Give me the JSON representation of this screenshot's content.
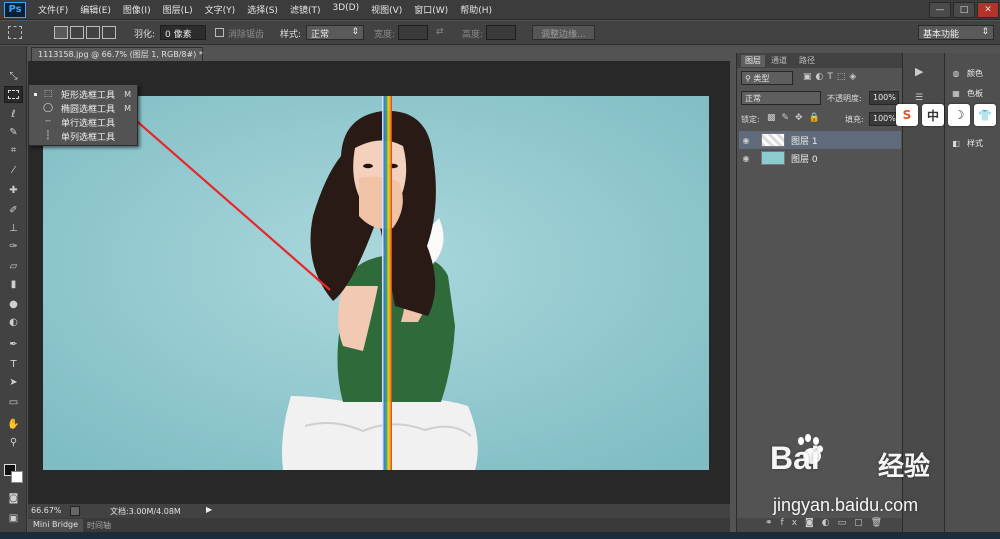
{
  "app": {
    "logo": "Ps"
  },
  "menu": [
    "文件(F)",
    "编辑(E)",
    "图像(I)",
    "图层(L)",
    "文字(Y)",
    "选择(S)",
    "滤镜(T)",
    "3D(D)",
    "视图(V)",
    "窗口(W)",
    "帮助(H)"
  ],
  "window_controls": {
    "minimize": "—",
    "restore": "□",
    "close": "✕"
  },
  "options": {
    "feather_label": "羽化:",
    "feather_value": "0 像素",
    "antialias_label": "消除锯齿",
    "style_label": "样式:",
    "style_value": "正常",
    "width_label": "宽度:",
    "height_label": "高度:",
    "refine_edge": "调整边缘...",
    "workspace": "基本功能"
  },
  "document": {
    "tab_title": "1113158.jpg @ 66.7% (图层 1, RGB/8#) *",
    "zoom": "66.67%",
    "doc_size": "文档:3.00M/4.08M",
    "bottom_tabs": [
      "Mini Bridge",
      "时间轴"
    ]
  },
  "flyout": {
    "items": [
      {
        "label": "矩形选框工具",
        "key": "M",
        "icon": "rect-marquee-icon"
      },
      {
        "label": "椭圆选框工具",
        "key": "M",
        "icon": "ellipse-marquee-icon"
      },
      {
        "label": "单行选框工具",
        "key": "",
        "icon": "single-row-marquee-icon"
      },
      {
        "label": "单列选框工具",
        "key": "",
        "icon": "single-column-marquee-icon"
      }
    ]
  },
  "layers_panel": {
    "tabs": [
      "图层",
      "通道",
      "路径"
    ],
    "kind_filter": "类型",
    "blend_mode": "正常",
    "opacity_label": "不透明度:",
    "opacity_value": "100%",
    "lock_label": "锁定:",
    "fill_label": "填充:",
    "fill_value": "100%",
    "layers": [
      {
        "name": "图层 1",
        "selected": true
      },
      {
        "name": "图层 0",
        "selected": false
      }
    ]
  },
  "right_panel": {
    "items": [
      "颜色",
      "色板",
      "样式"
    ]
  },
  "ime": {
    "items": [
      "S",
      "中",
      "☽",
      "👕"
    ]
  },
  "watermark": {
    "brand": "Bai",
    "brand_cn": "经验",
    "url": "jingyan.baidu.com"
  },
  "colors": {
    "accent": "#31a8ff",
    "arrow": "#e8262a",
    "canvas_bg": "#9bcdd2"
  }
}
